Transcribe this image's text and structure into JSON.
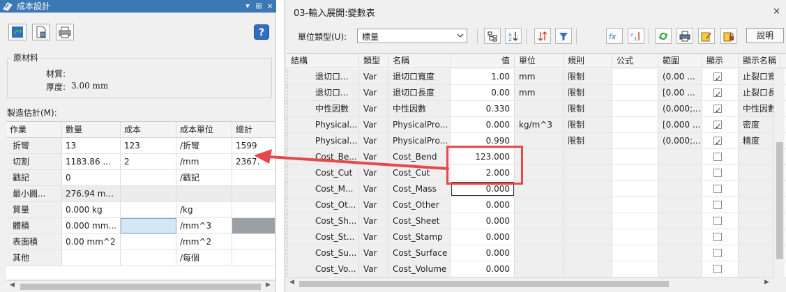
{
  "left_panel": {
    "title": "成本設計",
    "title_buttons": [
      "▾",
      "⊞",
      "×"
    ],
    "help_label": "?",
    "material": {
      "legend": "原材料",
      "material_label": "材質:",
      "thickness_label": "厚度:",
      "thickness_value": "3.00 mm"
    },
    "estimate_label": "製造估計(M):",
    "estimate_table": {
      "columns": [
        "作業",
        "數量",
        "成本",
        "成本單位",
        "總計"
      ],
      "rows": [
        [
          "折彎",
          "13",
          "123",
          "/折彎",
          "1599"
        ],
        [
          "切割",
          "1183.86 ...",
          "2",
          "/mm",
          "2367."
        ],
        [
          "戳記",
          "0",
          "",
          "/戳記",
          ""
        ],
        [
          "最小圓...",
          "276.94 m...",
          "",
          "",
          ""
        ],
        [
          "質量",
          "0.000 kg",
          "",
          "/kg",
          ""
        ],
        [
          "體積",
          "0.000 mm...",
          "",
          "/mm^3",
          ""
        ],
        [
          "表面積",
          "0.00 mm^2",
          "",
          "/mm^2",
          ""
        ],
        [
          "其他",
          "",
          "",
          "/每個",
          ""
        ]
      ]
    }
  },
  "right_panel": {
    "title": "03-輸入展開:變數表",
    "close_label": "×",
    "unit_type_label": "單位類型(U):",
    "unit_type_value": "標量",
    "explain_label": "說明",
    "toolbar_icons": [
      "tree-icon",
      "sort-az-icon",
      "sort-arrows-icon",
      "filter-icon",
      "function-icon",
      "sort-numeric-icon",
      "refresh-icon",
      "print-icon",
      "edit-icon",
      "lock-icon"
    ],
    "table": {
      "columns": [
        "結構",
        "類型",
        "名稱",
        "值",
        "單位",
        "規則",
        "公式",
        "範圍",
        "顯示",
        "顯示名稱"
      ],
      "rows": [
        {
          "structure": "退切口...",
          "type": "Var",
          "name": "退切口寬度",
          "value": "1.00",
          "unit": "mm",
          "rule": "限制",
          "formula": "",
          "range": "(0.00 ...",
          "show": true,
          "display": "止裂口寬"
        },
        {
          "structure": "退切口...",
          "type": "Var",
          "name": "退切口長度",
          "value": "0.00",
          "unit": "mm",
          "rule": "限制",
          "formula": "",
          "range": "[0.00 ...",
          "show": true,
          "display": "止裂口長"
        },
        {
          "structure": "中性因數",
          "type": "Var",
          "name": "中性因數",
          "value": "0.330",
          "unit": "",
          "rule": "限制",
          "formula": "",
          "range": "(0.000;...",
          "show": true,
          "display": "中性因數"
        },
        {
          "structure": "Physical...",
          "type": "Var",
          "name": "PhysicalPro...",
          "value": "0.000",
          "unit": "kg/m^3",
          "rule": "限制",
          "formula": "",
          "range": "[0.000 ...",
          "show": true,
          "display": "密度"
        },
        {
          "structure": "Physical...",
          "type": "Var",
          "name": "PhysicalPro...",
          "value": "0.990",
          "unit": "",
          "rule": "限制",
          "formula": "",
          "range": "(0.000;...",
          "show": true,
          "display": "精度"
        },
        {
          "structure": "Cost_Be...",
          "type": "Var",
          "name": "Cost_Bend",
          "value": "123.000",
          "unit": "",
          "rule": "",
          "formula": "",
          "range": "",
          "show": false,
          "display": ""
        },
        {
          "structure": "Cost_Cut",
          "type": "Var",
          "name": "Cost_Cut",
          "value": "2.000",
          "unit": "",
          "rule": "",
          "formula": "",
          "range": "",
          "show": false,
          "display": ""
        },
        {
          "structure": "Cost_M...",
          "type": "Var",
          "name": "Cost_Mass",
          "value": "0.000",
          "unit": "",
          "rule": "",
          "formula": "",
          "range": "",
          "show": false,
          "display": ""
        },
        {
          "structure": "Cost_Ot...",
          "type": "Var",
          "name": "Cost_Other",
          "value": "0.000",
          "unit": "",
          "rule": "",
          "formula": "",
          "range": "",
          "show": false,
          "display": ""
        },
        {
          "structure": "Cost_Sh...",
          "type": "Var",
          "name": "Cost_Sheet",
          "value": "0.000",
          "unit": "",
          "rule": "",
          "formula": "",
          "range": "",
          "show": false,
          "display": ""
        },
        {
          "structure": "Cost_St...",
          "type": "Var",
          "name": "Cost_Stamp",
          "value": "0.000",
          "unit": "",
          "rule": "",
          "formula": "",
          "range": "",
          "show": false,
          "display": ""
        },
        {
          "structure": "Cost_Su...",
          "type": "Var",
          "name": "Cost_Surface",
          "value": "0.000",
          "unit": "",
          "rule": "",
          "formula": "",
          "range": "",
          "show": false,
          "display": ""
        },
        {
          "structure": "Cost_Vo...",
          "type": "Var",
          "name": "Cost_Volume",
          "value": "0.000",
          "unit": "",
          "rule": "",
          "formula": "",
          "range": "",
          "show": false,
          "display": ""
        }
      ]
    }
  },
  "colors": {
    "title_bar": "#3c78b4",
    "annotation_red": "#e5484d",
    "selected_cell": "#d6e6f7"
  }
}
